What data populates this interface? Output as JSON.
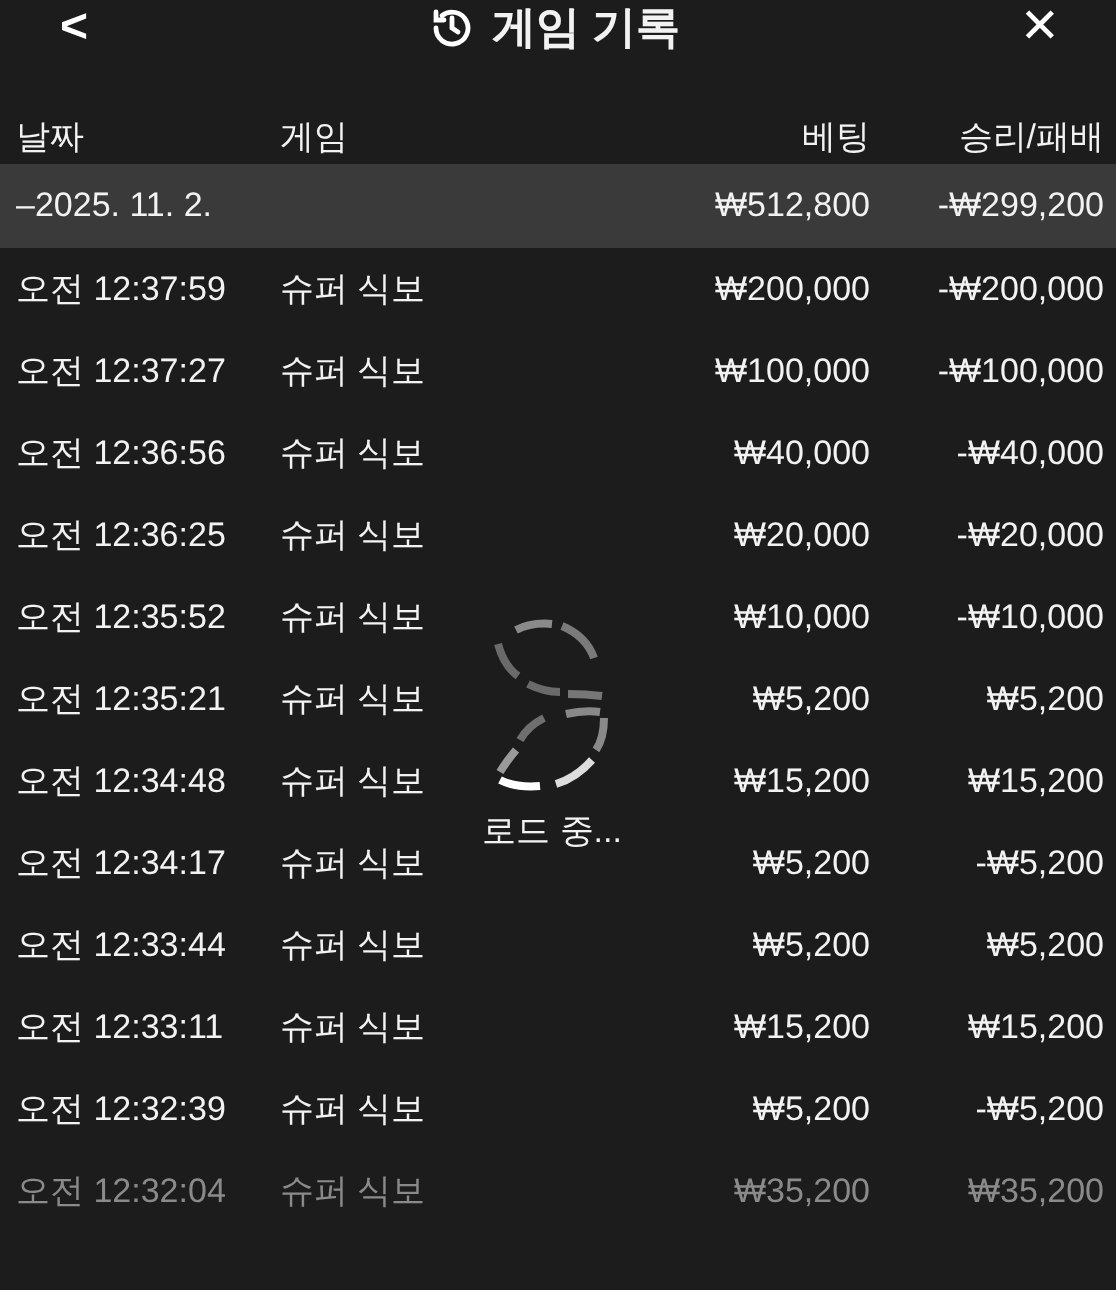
{
  "header": {
    "back": "<",
    "title": "게임 기록",
    "close": "✕"
  },
  "columns": [
    "날짜",
    "게임",
    "베팅",
    "승리/패배"
  ],
  "summary": {
    "toggle": "–",
    "date": "2025. 11. 2.",
    "bet": "₩512,800",
    "result": "-₩299,200"
  },
  "rows": [
    {
      "time": "오전 12:37:59",
      "game": "슈퍼 식보",
      "bet": "₩200,000",
      "result": "-₩200,000",
      "dimmed": false
    },
    {
      "time": "오전 12:37:27",
      "game": "슈퍼 식보",
      "bet": "₩100,000",
      "result": "-₩100,000",
      "dimmed": false
    },
    {
      "time": "오전 12:36:56",
      "game": "슈퍼 식보",
      "bet": "₩40,000",
      "result": "-₩40,000",
      "dimmed": false
    },
    {
      "time": "오전 12:36:25",
      "game": "슈퍼 식보",
      "bet": "₩20,000",
      "result": "-₩20,000",
      "dimmed": false
    },
    {
      "time": "오전 12:35:52",
      "game": "슈퍼 식보",
      "bet": "₩10,000",
      "result": "-₩10,000",
      "dimmed": false
    },
    {
      "time": "오전 12:35:21",
      "game": "슈퍼 식보",
      "bet": "₩5,200",
      "result": "₩5,200",
      "dimmed": false
    },
    {
      "time": "오전 12:34:48",
      "game": "슈퍼 식보",
      "bet": "₩15,200",
      "result": "₩15,200",
      "dimmed": false
    },
    {
      "time": "오전 12:34:17",
      "game": "슈퍼 식보",
      "bet": "₩5,200",
      "result": "-₩5,200",
      "dimmed": false
    },
    {
      "time": "오전 12:33:44",
      "game": "슈퍼 식보",
      "bet": "₩5,200",
      "result": "₩5,200",
      "dimmed": false
    },
    {
      "time": "오전 12:33:11",
      "game": "슈퍼 식보",
      "bet": "₩15,200",
      "result": "₩15,200",
      "dimmed": false
    },
    {
      "time": "오전 12:32:39",
      "game": "슈퍼 식보",
      "bet": "₩5,200",
      "result": "-₩5,200",
      "dimmed": false
    },
    {
      "time": "오전 12:32:04",
      "game": "슈퍼 식보",
      "bet": "₩35,200",
      "result": "₩35,200",
      "dimmed": true
    }
  ],
  "loading": {
    "label": "로드 중..."
  }
}
